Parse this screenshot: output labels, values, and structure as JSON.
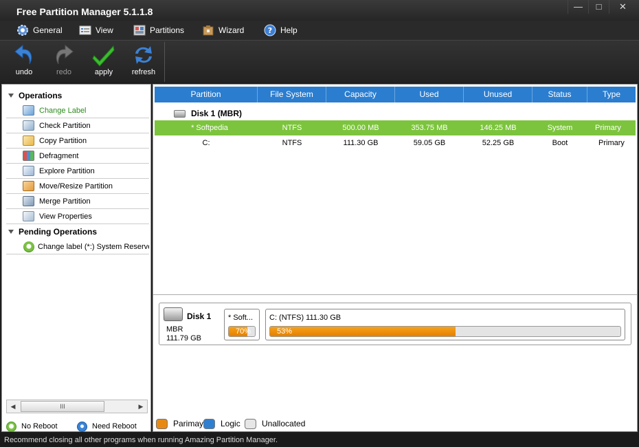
{
  "window": {
    "title": "Free Partition Manager 5.1.1.8",
    "minimize": "—",
    "maximize": "□",
    "close": "✕"
  },
  "menu": [
    {
      "label": "General",
      "icon": "gear-icon"
    },
    {
      "label": "View",
      "icon": "view-icon"
    },
    {
      "label": "Partitions",
      "icon": "partitions-icon"
    },
    {
      "label": "Wizard",
      "icon": "wizard-icon"
    },
    {
      "label": "Help",
      "icon": "help-icon"
    }
  ],
  "toolbar": [
    {
      "label": "undo",
      "icon": "undo-icon",
      "enabled": true
    },
    {
      "label": "redo",
      "icon": "redo-icon",
      "enabled": false
    },
    {
      "label": "apply",
      "icon": "checkmark-icon",
      "enabled": true
    },
    {
      "label": "refresh",
      "icon": "refresh-icon",
      "enabled": true
    }
  ],
  "operations": {
    "header": "Operations",
    "items": [
      {
        "label": "Change Label",
        "active": true,
        "color": "#6aa2d8"
      },
      {
        "label": "Check Partition",
        "active": false,
        "color": "#8fb0cf"
      },
      {
        "label": "Copy Partition",
        "active": false,
        "color": "#e8b84a"
      },
      {
        "label": "Defragment",
        "active": false,
        "color": "#d9534f"
      },
      {
        "label": "Explore Partition",
        "active": false,
        "color": "#9bb7d6"
      },
      {
        "label": "Move/Resize Partition",
        "active": false,
        "color": "#e39a3b"
      },
      {
        "label": "Merge Partition",
        "active": false,
        "color": "#7f9ab8"
      },
      {
        "label": "View Properties",
        "active": false,
        "color": "#a9bfd4"
      }
    ]
  },
  "pending": {
    "header": "Pending Operations",
    "items": [
      {
        "label": "Change label (*:) System Reserved"
      }
    ]
  },
  "scrollbar": {
    "left": "◀",
    "right": "▶",
    "grip": "III"
  },
  "reboot_legend": [
    {
      "label": "No Reboot",
      "color": "#7bc043"
    },
    {
      "label": "Need Reboot",
      "color": "#3a84d4"
    }
  ],
  "table": {
    "columns": [
      "Partition",
      "File System",
      "Capacity",
      "Used",
      "Unused",
      "Status",
      "Type"
    ],
    "disk_label": "Disk 1 (MBR)",
    "rows": [
      {
        "partition": "*  Softpedia",
        "fs": "NTFS",
        "capacity": "500.00 MB",
        "used": "353.75 MB",
        "unused": "146.25 MB",
        "status": "System",
        "type": "Primary",
        "selected": true
      },
      {
        "partition": "C:",
        "fs": "NTFS",
        "capacity": "111.30 GB",
        "used": "59.05 GB",
        "unused": "52.25 GB",
        "status": "Boot",
        "type": "Primary",
        "selected": false
      }
    ]
  },
  "diskmap": {
    "disk_title": "Disk 1",
    "disk_type": "MBR",
    "disk_size": "111.79 GB",
    "partitions": [
      {
        "name": "*  Soft...",
        "percent_label": "70%",
        "fill_percent": 70
      },
      {
        "name": "C: (NTFS) 111.30 GB",
        "percent_label": "53%",
        "fill_percent": 53
      }
    ]
  },
  "legend": [
    {
      "label": "Parimay",
      "color": "#e88a12"
    },
    {
      "label": "Logic",
      "color": "#2f7fd0"
    },
    {
      "label": "Unallocated",
      "color": "#e6e6e6"
    }
  ],
  "status_text": "Recommend closing all other programs when running Amazing Partition Manager."
}
